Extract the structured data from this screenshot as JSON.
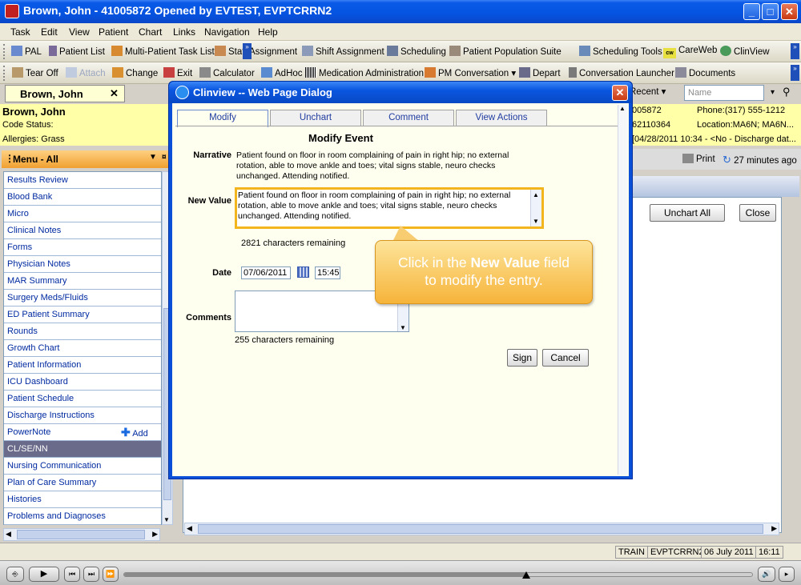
{
  "window": {
    "title": "Brown, John - 41005872 Opened by EVTEST, EVPTCRRN2"
  },
  "menubar": [
    "Task",
    "Edit",
    "View",
    "Patient",
    "Chart",
    "Links",
    "Navigation",
    "Help"
  ],
  "toolbar1": {
    "items": [
      "PAL",
      "Patient List",
      "Multi-Patient Task List",
      "Staff Assignment",
      "Shift Assignment",
      "Scheduling",
      "Patient Population Suite",
      "Scheduling Tools",
      "CareWeb",
      "ClinView"
    ],
    "careweb_icon_text": "cw"
  },
  "toolbar2": {
    "items": [
      "Tear Off",
      "Attach",
      "Change",
      "Exit",
      "Calculator",
      "AdHoc",
      "Medication Administration",
      "PM Conversation",
      "Depart",
      "Conversation Launcher",
      "Documents"
    ]
  },
  "search": {
    "recent_label": "Recent",
    "name_placeholder": "Name"
  },
  "patient": {
    "tab_name": "Brown, John",
    "name": "Brown, John",
    "code_status": "Code Status:",
    "allergies": "Allergies: Grass",
    "mrn_partial": "005872",
    "fin_partial": "62110364",
    "phone": "Phone:(317) 555-1212",
    "location": "Location:MA6N; MA6N...",
    "admit": "[04/28/2011 10:34 - <No - Discharge dat..."
  },
  "content_toolbar": {
    "print_label": "Print",
    "refresh_text": "27 minutes ago",
    "unchart_all_label": "Unchart All",
    "close_label": "Close"
  },
  "left_menu": {
    "header": "Menu - All",
    "items": [
      "Results Review",
      "Blood Bank",
      "Micro",
      "Clinical Notes",
      "Forms",
      "Physician Notes",
      "MAR Summary",
      "Surgery Meds/Fluids",
      "ED Patient Summary",
      "Rounds",
      "Growth Chart",
      "Patient Information",
      "ICU Dashboard",
      "Patient Schedule",
      "Discharge Instructions",
      "PowerNote",
      "CL/SE/NN",
      "Nursing Communication",
      "Plan of Care Summary",
      "Histories",
      "Problems and Diagnoses"
    ],
    "add_label": "Add",
    "selected": "CL/SE/NN"
  },
  "dialog": {
    "title": "Clinview -- Web Page Dialog",
    "tabs": [
      "Modify",
      "Unchart",
      "Comment",
      "View Actions"
    ],
    "heading": "Modify Event",
    "narrative_label": "Narrative",
    "narrative_text": "Patient found on floor in room complaining of pain in right hip; no external rotation, able to move ankle and toes; vital signs stable, neuro checks unchanged. Attending notified.",
    "new_value_label": "New Value",
    "new_value_text": "Patient found on floor in room complaining of pain in right hip; no external rotation, able to move ankle and toes; vital signs stable, neuro checks unchanged. Attending notified.",
    "new_value_remaining": "2821 characters remaining",
    "date_label": "Date",
    "date_value": "07/06/2011",
    "time_value": "15:45",
    "comments_label": "Comments",
    "comments_remaining": "255 characters remaining",
    "sign_label": "Sign",
    "cancel_label": "Cancel"
  },
  "callout": {
    "text_before": "Click in the ",
    "text_bold": "New Value",
    "text_after": " field",
    "line2": "to modify the entry."
  },
  "statusbar": {
    "env": "TRAIN",
    "user": "EVPTCRRN2",
    "date": "06 July 2011",
    "time": "16:11"
  },
  "playback": {
    "progress": 0.64
  }
}
